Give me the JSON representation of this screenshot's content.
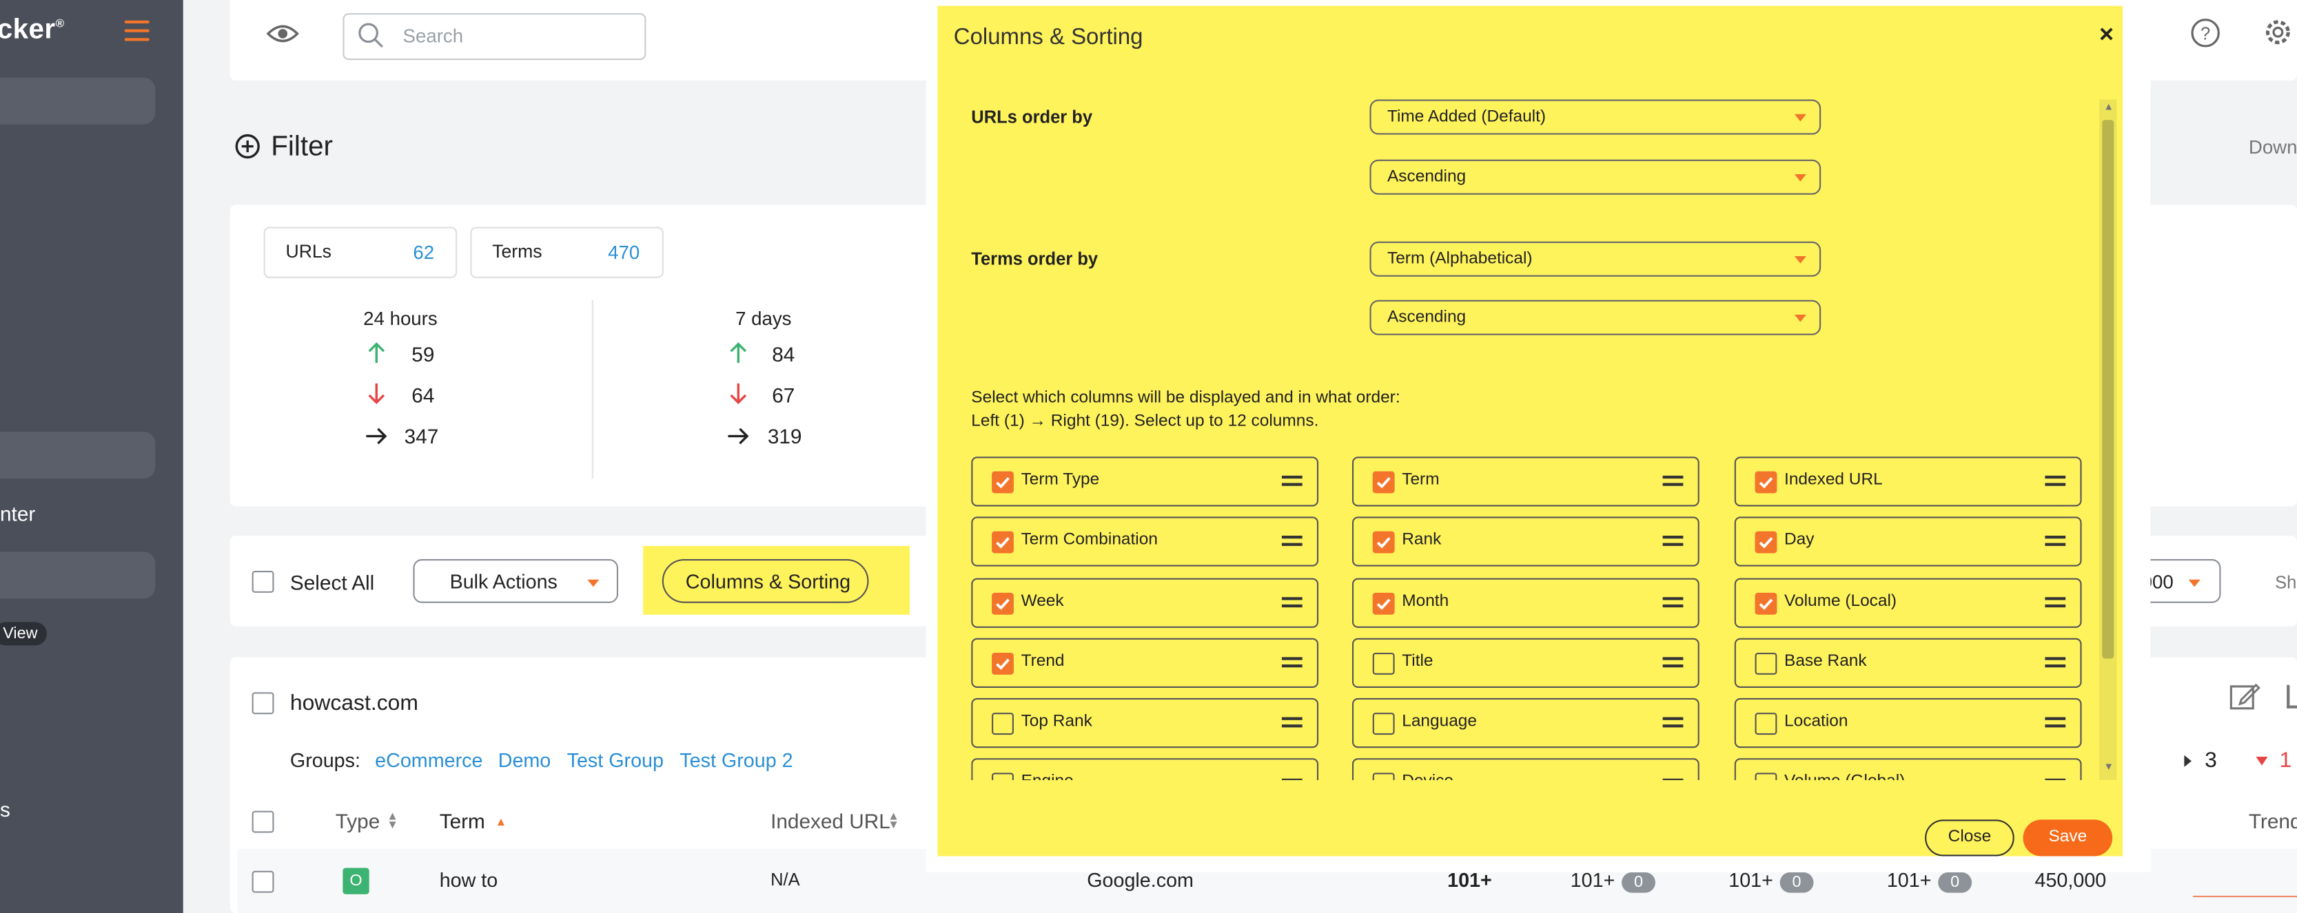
{
  "sidebar": {
    "logo_text": "cker",
    "logo_mark": "®",
    "item_enter": "nter",
    "badge_view": "View",
    "item_s": "s"
  },
  "topbar": {
    "search_placeholder": "Search"
  },
  "filter": {
    "label": "Filter",
    "download_label": "Down"
  },
  "stats": {
    "tabs": [
      {
        "label": "URLs",
        "count": "62"
      },
      {
        "label": "Terms",
        "count": "470"
      }
    ],
    "periods": [
      {
        "label": "24 hours",
        "up": "59",
        "down": "64",
        "same": "347"
      },
      {
        "label": "7 days",
        "up": "84",
        "down": "67",
        "same": "319"
      }
    ]
  },
  "toolbar": {
    "select_all": "Select All",
    "bulk_actions": "Bulk Actions",
    "columns_sorting": "Columns & Sorting",
    "per_page": "000",
    "show_label": "Sh"
  },
  "project": {
    "name": "howcast.com",
    "groups_label": "Groups:",
    "groups": [
      "eCommerce",
      "Demo",
      "Test Group",
      "Test Group 2"
    ],
    "pager_a": "3",
    "pager_b": "1",
    "columns": {
      "type": "Type",
      "term": "Term",
      "indexed_url": "Indexed URL",
      "trend": "Trend"
    },
    "row": {
      "type_badge": "O",
      "term": "how to",
      "indexed_url": "N/A",
      "engine": "Google.com",
      "rank": "101+",
      "day": "101+",
      "day_change": "0",
      "week": "101+",
      "week_change": "0",
      "month": "101+",
      "month_change": "0",
      "volume": "450,000"
    }
  },
  "modal": {
    "title": "Columns & Sorting",
    "close_x": "×",
    "urls_order_label": "URLs order by",
    "urls_order_value": "Time Added (Default)",
    "urls_direction": "Ascending",
    "terms_order_label": "Terms order by",
    "terms_order_value": "Term (Alphabetical)",
    "terms_direction": "Ascending",
    "columns_heading": "Select which columns will be displayed and in what order:",
    "columns_sub": "Left (1) → Right (19). Select up to 12 columns.",
    "columns": [
      [
        {
          "label": "Term Type",
          "checked": true
        },
        {
          "label": "Term",
          "checked": true
        },
        {
          "label": "Indexed URL",
          "checked": true
        }
      ],
      [
        {
          "label": "Term Combination",
          "checked": true
        },
        {
          "label": "Rank",
          "checked": true
        },
        {
          "label": "Day",
          "checked": true
        }
      ],
      [
        {
          "label": "Week",
          "checked": true
        },
        {
          "label": "Month",
          "checked": true
        },
        {
          "label": "Volume (Local)",
          "checked": true
        }
      ],
      [
        {
          "label": "Trend",
          "checked": true
        },
        {
          "label": "Title",
          "checked": false
        },
        {
          "label": "Base Rank",
          "checked": false
        }
      ],
      [
        {
          "label": "Top Rank",
          "checked": false
        },
        {
          "label": "Language",
          "checked": false
        },
        {
          "label": "Location",
          "checked": false
        }
      ]
    ],
    "partial_row": [
      "Engine",
      "Device",
      "Volume (Global)"
    ],
    "close_button": "Close",
    "save_button": "Save",
    "accent_color": "#f2752b",
    "highlight_color": "#fff35c"
  }
}
